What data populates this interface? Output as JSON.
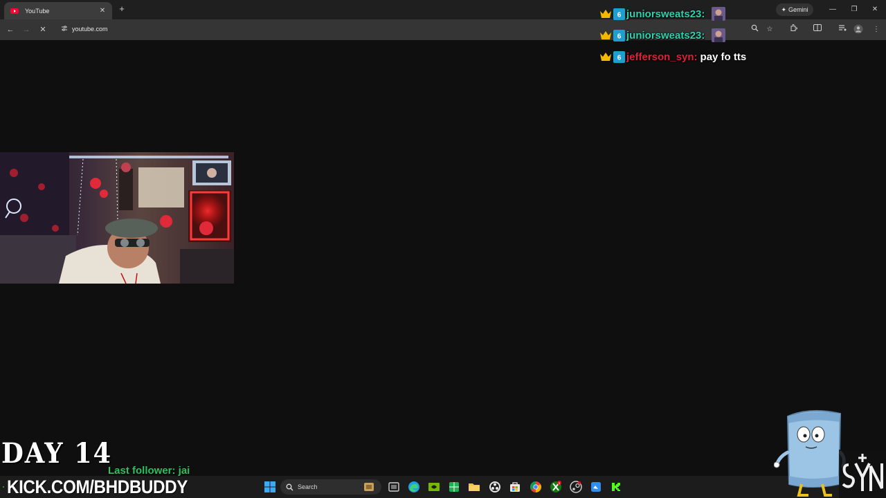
{
  "browser": {
    "tab": {
      "title": "YouTube",
      "close": "✕",
      "favicon": "youtube-icon"
    },
    "new_tab": "+",
    "gemini": {
      "label": "Gemini",
      "icon": "sparkle-icon"
    },
    "window_controls": {
      "minimize": "—",
      "restore": "❐",
      "close": "✕"
    },
    "url": "youtube.com",
    "nav": {
      "back": "←",
      "forward": "→",
      "reload": "✕",
      "site_info": "⚙"
    }
  },
  "chat": {
    "messages": [
      {
        "user": "juniorsweats23:",
        "text": "",
        "user_color": "#2ed3b0",
        "has_avatar": true
      },
      {
        "user": "juniorsweats23:",
        "text": "",
        "user_color": "#2ed3b0",
        "has_avatar": true
      },
      {
        "user": "jefferson_syn:",
        "text": "pay fo tts",
        "user_color": "#e0203a",
        "has_avatar": false
      }
    ]
  },
  "overlay": {
    "day_label": "DAY 14",
    "last_follower": "Last follower: jai",
    "kick_url": "KICK.COM/BHDBUDDY"
  },
  "taskbar": {
    "search_placeholder": "Search",
    "icons": [
      "windows-start-icon",
      "search-icon",
      "file-explorer-icon",
      "edge-icon",
      "nvidia-icon",
      "spreadsheet-icon",
      "folder-icon",
      "obs-icon",
      "store-icon",
      "chrome-icon",
      "xbox-icon",
      "steam-icon",
      "photos-icon",
      "kick-icon"
    ]
  },
  "colors": {
    "page_bg": "#0f0f0f",
    "chrome_toolbar": "#353535",
    "kick_green": "#53fc18",
    "follower_green": "#30c060"
  }
}
